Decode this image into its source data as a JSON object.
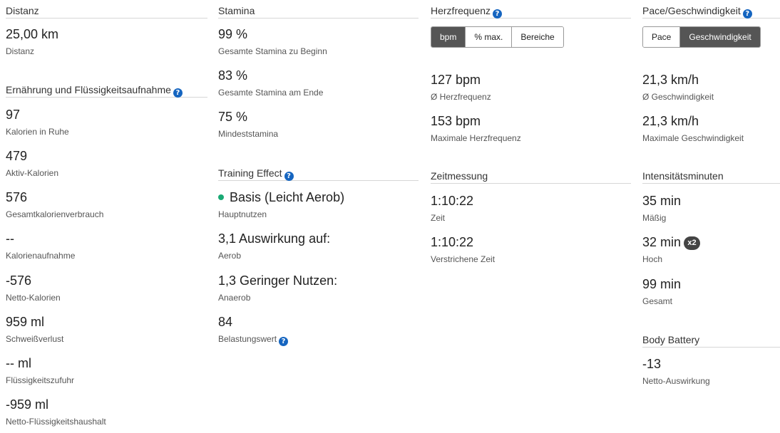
{
  "distance": {
    "title": "Distanz",
    "value": "25,00 km",
    "label": "Distanz"
  },
  "nutrition": {
    "title": "Ernährung und Flüssigkeitsaufnahme",
    "help": "?",
    "items": [
      {
        "value": "97",
        "label": "Kalorien in Ruhe"
      },
      {
        "value": "479",
        "label": "Aktiv-Kalorien"
      },
      {
        "value": "576",
        "label": "Gesamtkalorienverbrauch"
      },
      {
        "value": "--",
        "label": "Kalorienaufnahme"
      },
      {
        "value": "-576",
        "label": "Netto-Kalorien"
      },
      {
        "value": "959 ml",
        "label": "Schweißverlust"
      },
      {
        "value": "-- ml",
        "label": "Flüssigkeitszufuhr"
      },
      {
        "value": "-959 ml",
        "label": "Netto-Flüssigkeitshaushalt"
      }
    ]
  },
  "stamina": {
    "title": "Stamina",
    "items": [
      {
        "value": "99 %",
        "label": "Gesamte Stamina zu Beginn"
      },
      {
        "value": "83 %",
        "label": "Gesamte Stamina am Ende"
      },
      {
        "value": "75 %",
        "label": "Mindeststamina"
      }
    ]
  },
  "training_effect": {
    "title": "Training Effect",
    "help": "?",
    "dot_color": "#19a974",
    "items": [
      {
        "value": "Basis (Leicht Aerob)",
        "label": "Hauptnutzen"
      },
      {
        "value": "3,1 Auswirkung auf:",
        "label": "Aerob"
      },
      {
        "value": "1,3 Geringer Nutzen:",
        "label": "Anaerob"
      },
      {
        "value": "84",
        "label": "Belastungswert"
      }
    ]
  },
  "heart_rate": {
    "title": "Herzfrequenz",
    "help": "?",
    "toggle": [
      "bpm",
      "% max.",
      "Bereiche"
    ],
    "toggle_active": "bpm",
    "items": [
      {
        "value": "127 bpm",
        "label": "Ø Herzfrequenz"
      },
      {
        "value": "153 bpm",
        "label": "Maximale Herzfrequenz"
      }
    ]
  },
  "timing": {
    "title": "Zeitmessung",
    "items": [
      {
        "value": "1:10:22",
        "label": "Zeit"
      },
      {
        "value": "1:10:22",
        "label": "Verstrichene Zeit"
      }
    ]
  },
  "pace": {
    "title": "Pace/Geschwindigkeit",
    "help": "?",
    "toggle": [
      "Pace",
      "Geschwindigkeit"
    ],
    "toggle_active": "Geschwindigkeit",
    "items": [
      {
        "value": "21,3 km/h",
        "label": "Ø Geschwindigkeit"
      },
      {
        "value": "21,3 km/h",
        "label": "Maximale Geschwindigkeit"
      }
    ]
  },
  "intensity": {
    "title": "Intensitätsminuten",
    "badge": "x2",
    "items": [
      {
        "value": "35 min",
        "label": "Mäßig"
      },
      {
        "value": "32 min",
        "label": "Hoch"
      },
      {
        "value": "99 min",
        "label": "Gesamt"
      }
    ]
  },
  "body_battery": {
    "title": "Body Battery",
    "items": [
      {
        "value": "-13",
        "label": "Netto-Auswirkung"
      }
    ]
  }
}
